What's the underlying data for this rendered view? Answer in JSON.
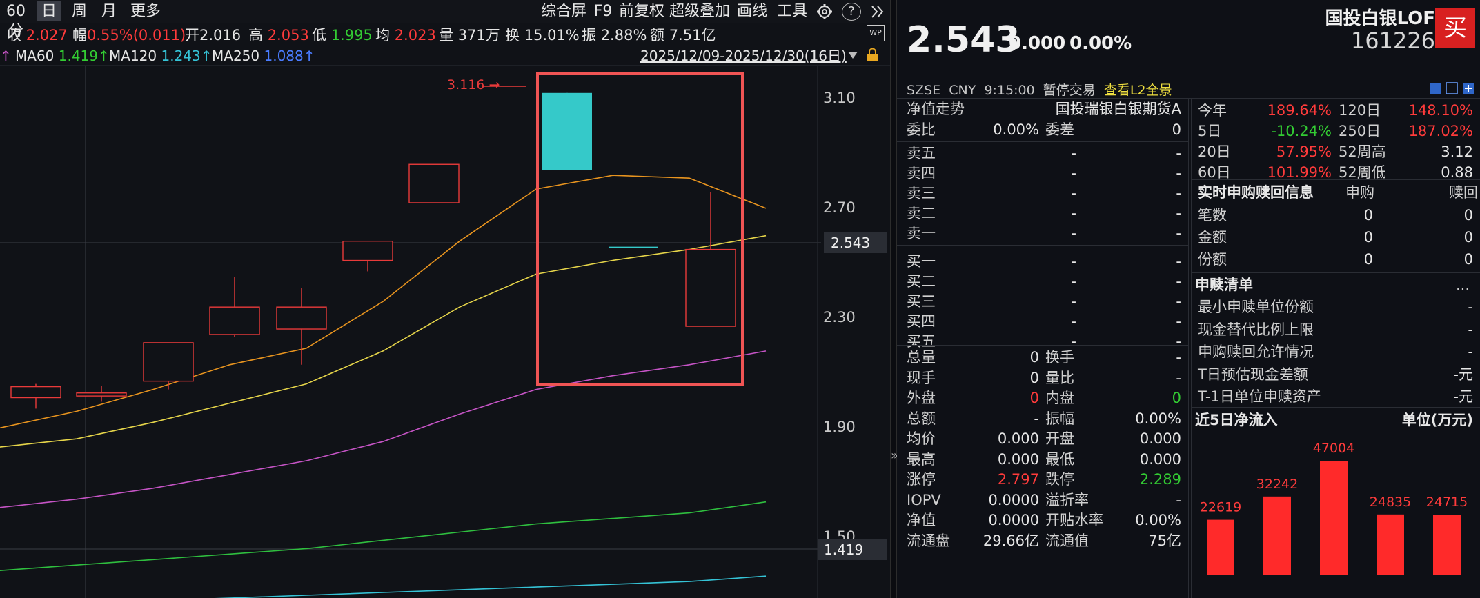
{
  "toolbar": {
    "period": "60分",
    "day": "日",
    "week": "周",
    "month": "月",
    "more": "更多",
    "fullscreen": "综合屏",
    "f9": "F9",
    "restore": "前复权",
    "overlay": "超级叠加",
    "draw": "画线",
    "tools": "工具",
    "gear_icon": "gear-icon",
    "help_icon": "help-icon",
    "expand_icon": "double-chevron-right-icon"
  },
  "stats": {
    "close_label": "收",
    "close": "2.027",
    "amp_label": "幅",
    "amp": "0.55%(0.011)",
    "open_label": "开",
    "open": "2.016",
    "high_label": "高",
    "high": "2.053",
    "low_label": "低",
    "low": "1.995",
    "avg_label": "均",
    "avg": "2.023",
    "vol_label": "量",
    "vol": "371万",
    "turn_label": "换",
    "turn": "15.01%",
    "swing_label": "振",
    "swing": "2.88%",
    "amount_label": "额",
    "amount": "7.51亿"
  },
  "ma": {
    "ma60_label": "MA60",
    "ma60": "1.419↑",
    "ma120_label": "MA120",
    "ma120": "1.243↑",
    "ma250_label": "MA250",
    "ma250": "1.088↑",
    "range": "2025/12/09-2025/12/30(16日)"
  },
  "chart": {
    "ymax_label": "3.116",
    "current_price": "2.543",
    "ma60_marker": "1.419",
    "colors": {
      "up": "#e83a3a",
      "highlight": "#35c9c9",
      "box": "#f05454",
      "ma_orange": "#e8941f",
      "ma_yellow": "#e6d54a",
      "ma_purple": "#c654c6",
      "ma_green": "#2fbf3f",
      "ma_cyan": "#35c3d6"
    }
  },
  "chart_data": {
    "type": "candlestick",
    "yticks": [
      "3.10",
      "2.70",
      "2.30",
      "1.90",
      "1.50"
    ],
    "ylim": [
      1.28,
      3.22
    ],
    "candles": [
      {
        "o": 2.01,
        "c": 2.05,
        "h": 2.06,
        "l": 1.97
      },
      {
        "o": 2.016,
        "c": 2.027,
        "h": 2.053,
        "l": 1.995
      },
      {
        "o": 2.07,
        "c": 2.21,
        "h": 2.21,
        "l": 2.04
      },
      {
        "o": 2.24,
        "c": 2.34,
        "h": 2.45,
        "l": 2.23
      },
      {
        "o": 2.26,
        "c": 2.34,
        "h": 2.41,
        "l": 2.13
      },
      {
        "o": 2.51,
        "c": 2.58,
        "h": 2.58,
        "l": 2.47
      },
      {
        "o": 2.72,
        "c": 2.86,
        "h": 2.86,
        "l": 2.72
      },
      {
        "o": 2.84,
        "c": 3.12,
        "h": 3.12,
        "l": 2.84,
        "highlight": true
      },
      {
        "o": 2.56,
        "c": 2.56,
        "h": 2.56,
        "l": 2.56,
        "highlight": true,
        "doji": true
      },
      {
        "o": 2.27,
        "c": 2.55,
        "h": 2.76,
        "l": 2.27
      }
    ],
    "series": [
      {
        "values": [
          1.9,
          1.96,
          2.04,
          2.13,
          2.19,
          2.36,
          2.58,
          2.77,
          2.82,
          2.81,
          2.7
        ]
      },
      {
        "values": [
          1.83,
          1.86,
          1.92,
          1.99,
          2.06,
          2.18,
          2.34,
          2.46,
          2.51,
          2.55,
          2.6
        ]
      },
      {
        "values": [
          1.61,
          1.64,
          1.68,
          1.73,
          1.78,
          1.85,
          1.95,
          2.04,
          2.09,
          2.13,
          2.18
        ]
      },
      {
        "values": [
          1.38,
          1.4,
          1.42,
          1.44,
          1.46,
          1.49,
          1.52,
          1.55,
          1.57,
          1.59,
          1.63
        ]
      },
      {
        "values": [
          1.25,
          1.26,
          1.27,
          1.28,
          1.29,
          1.3,
          1.31,
          1.32,
          1.33,
          1.34,
          1.36
        ]
      }
    ]
  },
  "quote": {
    "price": "2.543",
    "change": "0.000",
    "pct": "0.00%",
    "name": "国投白银LOF",
    "code": "161226",
    "buy_btn": "买",
    "exchange": "SZSE",
    "currency": "CNY",
    "time": "9:15:00",
    "status": "暂停交易",
    "l2": "查看L2全景"
  },
  "book": {
    "nav_label": "净值走势",
    "fund_name": "国投瑞银白银期货A",
    "wb_label": "委比",
    "wb": "0.00%",
    "wc_label": "委差",
    "wc": "0",
    "sells": [
      {
        "label": "卖五",
        "p": "-",
        "v": "-"
      },
      {
        "label": "卖四",
        "p": "-",
        "v": "-"
      },
      {
        "label": "卖三",
        "p": "-",
        "v": "-"
      },
      {
        "label": "卖二",
        "p": "-",
        "v": "-"
      },
      {
        "label": "卖一",
        "p": "-",
        "v": "-"
      }
    ],
    "buys": [
      {
        "label": "买一",
        "p": "-",
        "v": "-"
      },
      {
        "label": "买二",
        "p": "-",
        "v": "-"
      },
      {
        "label": "买三",
        "p": "-",
        "v": "-"
      },
      {
        "label": "买四",
        "p": "-",
        "v": "-"
      },
      {
        "label": "买五",
        "p": "-",
        "v": "-"
      }
    ],
    "stats": [
      {
        "l1": "总量",
        "v1": "0",
        "l2": "换手",
        "v2": "-"
      },
      {
        "l1": "现手",
        "v1": "0",
        "l2": "量比",
        "v2": "-"
      },
      {
        "l1": "外盘",
        "v1": "0",
        "l2": "内盘",
        "v2": "0"
      },
      {
        "l1": "总额",
        "v1": "-",
        "l2": "振幅",
        "v2": "0.00%"
      },
      {
        "l1": "均价",
        "v1": "0.000",
        "l2": "开盘",
        "v2": "0.000"
      },
      {
        "l1": "最高",
        "v1": "0.000",
        "l2": "最低",
        "v2": "0.000"
      },
      {
        "l1": "涨停",
        "v1": "2.797",
        "l2": "跌停",
        "v2": "2.289"
      },
      {
        "l1": "IOPV",
        "v1": "0.0000",
        "l2": "溢折率",
        "v2": "-"
      },
      {
        "l1": "净值",
        "v1": "0.0000",
        "l2": "开贴水率",
        "v2": "0.00%"
      },
      {
        "l1": "流通盘",
        "v1": "29.66亿",
        "l2": "流通值",
        "v2": "75亿"
      }
    ]
  },
  "perf": {
    "rows": [
      {
        "l1": "今年",
        "v1": "189.64%",
        "l2": "120日",
        "v2": "148.10%"
      },
      {
        "l1": "5日",
        "v1": "-10.24%",
        "l2": "250日",
        "v2": "187.02%"
      },
      {
        "l1": "20日",
        "v1": "57.95%",
        "l2": "52周高",
        "v2": "3.12"
      },
      {
        "l1": "60日",
        "v1": "101.99%",
        "l2": "52周低",
        "v2": "0.88"
      }
    ],
    "sub_title": "实时申购赎回信息",
    "sub_col1": "申购",
    "sub_col2": "赎回",
    "sub_rows": [
      {
        "l": "笔数",
        "a": "0",
        "b": "0"
      },
      {
        "l": "金额",
        "a": "0",
        "b": "0"
      },
      {
        "l": "份额",
        "a": "0",
        "b": "0"
      }
    ],
    "list_title": "申赎清单",
    "list_more": "...",
    "list_rows": [
      {
        "l": "最小申赎单位份额",
        "v": "-"
      },
      {
        "l": "现金替代比例上限",
        "v": "-"
      },
      {
        "l": "申购赎回允许情况",
        "v": "-"
      },
      {
        "l": "T日预估现金差额",
        "v": "-元"
      },
      {
        "l": "T-1日单位申赎资产",
        "v": "-元"
      }
    ],
    "flow_title": "近5日净流入",
    "flow_unit": "单位(万元)",
    "flow": [
      22619,
      32242,
      47004,
      24835,
      24715
    ],
    "flow_labels": [
      "22619",
      "32242",
      "47004",
      "24835",
      "24715"
    ]
  }
}
